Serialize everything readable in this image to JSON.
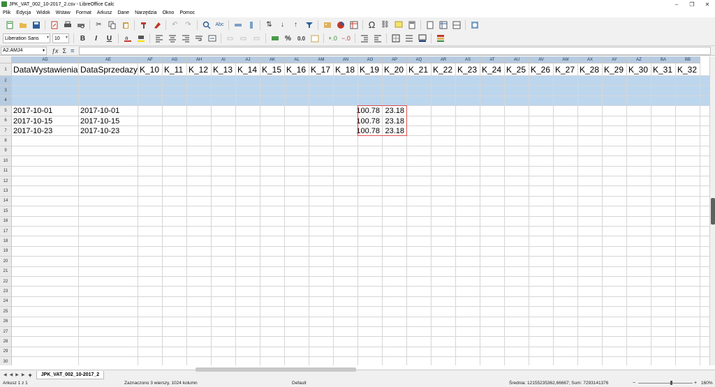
{
  "window": {
    "title": "JPK_VAT_002_10-2017_2.csv - LibreOffice Calc",
    "controls": {
      "minimize": "–",
      "maximize": "❐",
      "close": "✕"
    }
  },
  "menu": [
    "Plik",
    "Edycja",
    "Widok",
    "Wstaw",
    "Format",
    "Arkusz",
    "Dane",
    "Narzędzia",
    "Okno",
    "Pomoc"
  ],
  "toolbar": {
    "font_name": "Liberation Sans",
    "font_size": "10",
    "percent_label": "%",
    "decimal_label": "0.0",
    "omega": "Ω",
    "bold": "B",
    "italic": "I",
    "underline": "U"
  },
  "formula_bar": {
    "name_box": "A2:AMJ4",
    "sum_icon": "Σ",
    "equals_icon": "=",
    "fx_icon": "ƒx",
    "input_value": ""
  },
  "sheet": {
    "columns": [
      "AD",
      "AE",
      "AF",
      "AG",
      "AH",
      "AI",
      "AJ",
      "AK",
      "AL",
      "AM",
      "AN",
      "AO",
      "AP",
      "AQ",
      "AR",
      "AS",
      "AT",
      "AU",
      "AV",
      "AW",
      "AX",
      "AY",
      "AZ",
      "BA",
      "BB"
    ],
    "rows": [
      "1",
      "2",
      "3",
      "4",
      "5",
      "6",
      "7",
      "8",
      "9",
      "10",
      "11",
      "12",
      "13",
      "14",
      "15",
      "16",
      "17",
      "18",
      "19",
      "20",
      "21",
      "22",
      "23",
      "24",
      "25",
      "26",
      "27",
      "28",
      "29",
      "30"
    ],
    "header_row": [
      "DataWystawienia",
      "DataSprzedazy",
      "K_10",
      "K_11",
      "K_12",
      "K_13",
      "K_14",
      "K_15",
      "K_16",
      "K_17",
      "K_18",
      "K_19",
      "K_20",
      "K_21",
      "K_22",
      "K_23",
      "K_24",
      "K_25",
      "K_26",
      "K_27",
      "K_28",
      "K_29",
      "K_30",
      "K_31",
      "K_32"
    ],
    "data_rows": [
      {
        "ad": "2017-10-01",
        "ae": "2017-10-01",
        "ao": "100.78",
        "ap": "23.18"
      },
      {
        "ad": "2017-10-15",
        "ae": "2017-10-15",
        "ao": "100.78",
        "ap": "23.18"
      },
      {
        "ad": "2017-10-23",
        "ae": "2017-10-23",
        "ao": "100.78",
        "ap": "23.18"
      }
    ],
    "selected_rows": [
      "2",
      "3",
      "4"
    ]
  },
  "tabs": {
    "add_label": "+",
    "sheet_name": "JPK_VAT_002_10-2017_2"
  },
  "status": {
    "sheet_pos": "Arkusz 1 z 1",
    "selection": "Zaznaczono 3 wierszy, 1024 kolumn",
    "page_style": "Default",
    "stats": "Średnia: 12155235362,66667; Sum: 7293141376",
    "zoom": "160%",
    "zoom_minus": "−",
    "zoom_plus": "+"
  },
  "colors": {
    "selection": "#bcd6ee",
    "header_bg": "#eaeaea",
    "highlight_border": "#e0504f"
  }
}
